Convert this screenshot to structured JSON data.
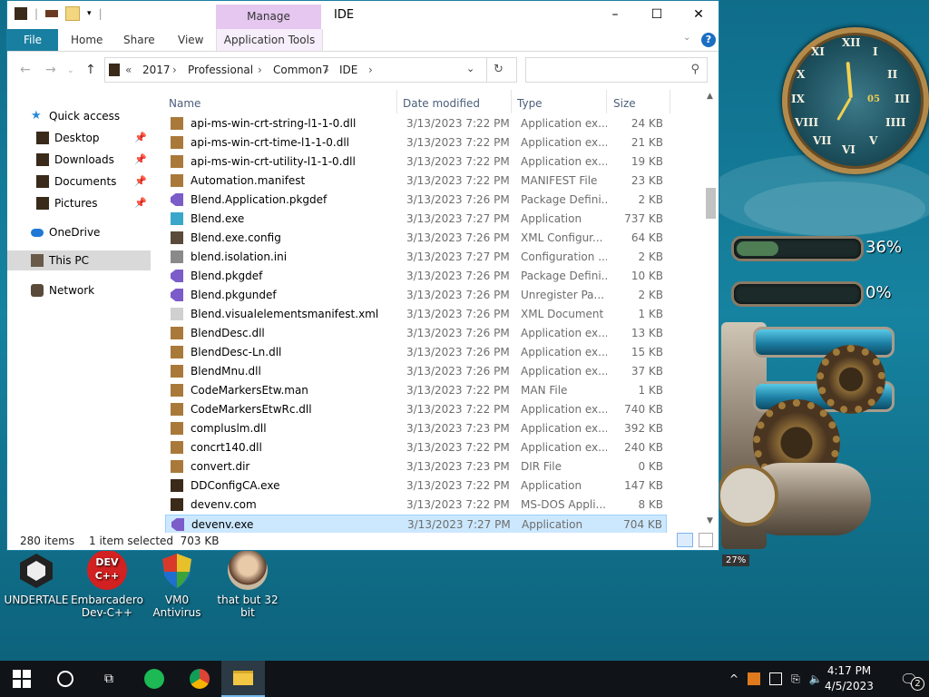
{
  "window": {
    "title": "IDE",
    "manage_tab": "Manage",
    "ribbon_tabs": [
      "File",
      "Home",
      "Share",
      "View",
      "Application Tools"
    ]
  },
  "address": {
    "overflow": "«",
    "crumbs": [
      "2017",
      "Professional",
      "Common7",
      "IDE"
    ],
    "search_placeholder": ""
  },
  "nav": {
    "quick_access": "Quick access",
    "items": [
      "Desktop",
      "Downloads",
      "Documents",
      "Pictures"
    ],
    "onedrive": "OneDrive",
    "this_pc": "This PC",
    "network": "Network"
  },
  "columns": [
    "Name",
    "Date modified",
    "Type",
    "Size"
  ],
  "files": [
    {
      "name": "api-ms-win-crt-string-l1-1-0.dll",
      "date": "3/13/2023 7:22 PM",
      "type": "Application ex...",
      "size": "24 KB",
      "icon": "dll"
    },
    {
      "name": "api-ms-win-crt-time-l1-1-0.dll",
      "date": "3/13/2023 7:22 PM",
      "type": "Application ex...",
      "size": "21 KB",
      "icon": "dll"
    },
    {
      "name": "api-ms-win-crt-utility-l1-1-0.dll",
      "date": "3/13/2023 7:22 PM",
      "type": "Application ex...",
      "size": "19 KB",
      "icon": "dll"
    },
    {
      "name": "Automation.manifest",
      "date": "3/13/2023 7:22 PM",
      "type": "MANIFEST File",
      "size": "23 KB",
      "icon": "dll"
    },
    {
      "name": "Blend.Application.pkgdef",
      "date": "3/13/2023 7:26 PM",
      "type": "Package Defini...",
      "size": "2 KB",
      "icon": "vs"
    },
    {
      "name": "Blend.exe",
      "date": "3/13/2023 7:27 PM",
      "type": "Application",
      "size": "737 KB",
      "icon": "blend"
    },
    {
      "name": "Blend.exe.config",
      "date": "3/13/2023 7:26 PM",
      "type": "XML Configur...",
      "size": "64 KB",
      "icon": "config"
    },
    {
      "name": "blend.isolation.ini",
      "date": "3/13/2023 7:27 PM",
      "type": "Configuration ...",
      "size": "2 KB",
      "icon": "ini"
    },
    {
      "name": "Blend.pkgdef",
      "date": "3/13/2023 7:26 PM",
      "type": "Package Defini...",
      "size": "10 KB",
      "icon": "vs"
    },
    {
      "name": "Blend.pkgundef",
      "date": "3/13/2023 7:26 PM",
      "type": "Unregister Pa...",
      "size": "2 KB",
      "icon": "vs"
    },
    {
      "name": "Blend.visualelementsmanifest.xml",
      "date": "3/13/2023 7:26 PM",
      "type": "XML Document",
      "size": "1 KB",
      "icon": "xml"
    },
    {
      "name": "BlendDesc.dll",
      "date": "3/13/2023 7:26 PM",
      "type": "Application ex...",
      "size": "13 KB",
      "icon": "dll"
    },
    {
      "name": "BlendDesc-Ln.dll",
      "date": "3/13/2023 7:26 PM",
      "type": "Application ex...",
      "size": "15 KB",
      "icon": "dll"
    },
    {
      "name": "BlendMnu.dll",
      "date": "3/13/2023 7:26 PM",
      "type": "Application ex...",
      "size": "37 KB",
      "icon": "dll"
    },
    {
      "name": "CodeMarkersEtw.man",
      "date": "3/13/2023 7:22 PM",
      "type": "MAN File",
      "size": "1 KB",
      "icon": "dll"
    },
    {
      "name": "CodeMarkersEtwRc.dll",
      "date": "3/13/2023 7:22 PM",
      "type": "Application ex...",
      "size": "740 KB",
      "icon": "dll"
    },
    {
      "name": "compluslm.dll",
      "date": "3/13/2023 7:23 PM",
      "type": "Application ex...",
      "size": "392 KB",
      "icon": "dll"
    },
    {
      "name": "concrt140.dll",
      "date": "3/13/2023 7:22 PM",
      "type": "Application ex...",
      "size": "240 KB",
      "icon": "dll"
    },
    {
      "name": "convert.dir",
      "date": "3/13/2023 7:23 PM",
      "type": "DIR File",
      "size": "0 KB",
      "icon": "dll"
    },
    {
      "name": "DDConfigCA.exe",
      "date": "3/13/2023 7:22 PM",
      "type": "Application",
      "size": "147 KB",
      "icon": "exe"
    },
    {
      "name": "devenv.com",
      "date": "3/13/2023 7:22 PM",
      "type": "MS-DOS Appli...",
      "size": "8 KB",
      "icon": "exe"
    },
    {
      "name": "devenv.exe",
      "date": "3/13/2023 7:27 PM",
      "type": "Application",
      "size": "704 KB",
      "icon": "vs",
      "selected": true
    }
  ],
  "status": {
    "count": "280 items",
    "selection": "1 item selected  703 KB"
  },
  "desktop_icons": [
    "UNDERTALE",
    "Embarcadero Dev-C++",
    "VM0 Antivirus",
    "that but 32 bit"
  ],
  "devcpp_badge": [
    "DEV",
    "C++"
  ],
  "gadgets": {
    "clock_numerals": [
      "XII",
      "I",
      "II",
      "III",
      "IIII",
      "V",
      "VI",
      "VII",
      "VIII",
      "IX",
      "X",
      "XI"
    ],
    "clock_date": "05",
    "cpu_percent": "36%",
    "cpu_fill": 0.36,
    "ram_percent": "0%",
    "ram_fill": 0.0,
    "dial_label": "27%"
  },
  "taskbar": {
    "time": "4:17 PM",
    "date": "4/5/2023",
    "notifications": "2"
  },
  "colors": {
    "accent": "#197fa0",
    "manage": "#e6c7f0",
    "selection": "#cce8ff"
  }
}
